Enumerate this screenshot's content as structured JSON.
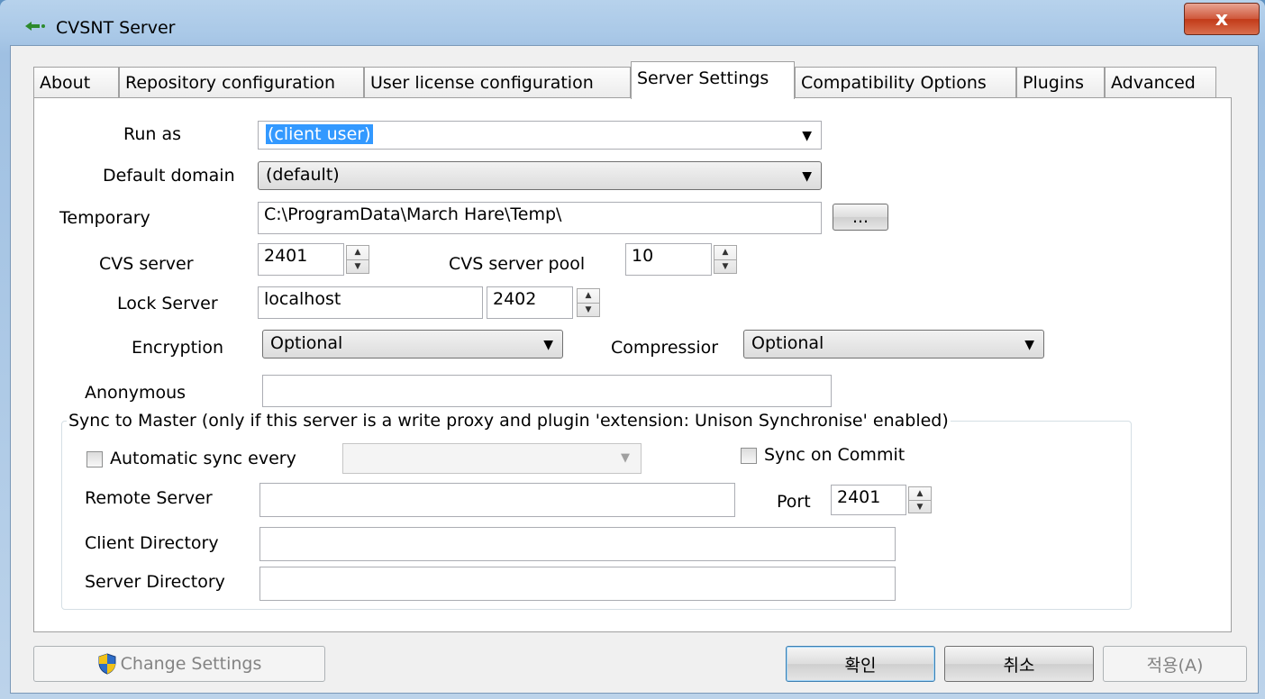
{
  "window": {
    "title": "CVSNT Server",
    "close_label": "x"
  },
  "tabs": [
    {
      "label": "About"
    },
    {
      "label": "Repository configuration"
    },
    {
      "label": "User license configuration"
    },
    {
      "label": "Server Settings",
      "active": true
    },
    {
      "label": "Compatibility Options"
    },
    {
      "label": "Plugins"
    },
    {
      "label": "Advanced"
    }
  ],
  "form": {
    "run_as_label": "Run as",
    "run_as_value": "(client user)",
    "default_domain_label": "Default domain",
    "default_domain_value": "(default)",
    "temporary_label": "Temporary",
    "temporary_value": "C:\\ProgramData\\March Hare\\Temp\\",
    "temporary_browse_label": "...",
    "cvs_server_label": "CVS server",
    "cvs_server_value": "2401",
    "cvs_server_pool_label": "CVS server pool",
    "cvs_server_pool_value": "10",
    "lock_server_label": "Lock Server",
    "lock_server_host": "localhost",
    "lock_server_port": "2402",
    "encryption_label": "Encryption",
    "encryption_value": "Optional",
    "compression_label": "Compressior",
    "compression_value": "Optional",
    "anonymous_label": "Anonymous",
    "anonymous_value": ""
  },
  "sync": {
    "group_title": "Sync to Master (only if this server is a write proxy and plugin 'extension: Unison Synchronise' enabled)",
    "auto_sync_label": "Automatic sync every",
    "auto_sync_checked": false,
    "auto_sync_value": "",
    "sync_on_commit_label": "Sync on Commit",
    "sync_on_commit_checked": false,
    "remote_server_label": "Remote Server",
    "remote_server_value": "",
    "port_label": "Port",
    "port_value": "2401",
    "client_directory_label": "Client Directory",
    "client_directory_value": "",
    "server_directory_label": "Server Directory",
    "server_directory_value": ""
  },
  "buttons": {
    "change_settings": "Change Settings",
    "ok": "확인",
    "cancel": "취소",
    "apply": "적용(A)"
  },
  "colors": {
    "selection": "#3399ff",
    "close_button": "#c23a18",
    "title_bar": "#a9c8e7"
  }
}
